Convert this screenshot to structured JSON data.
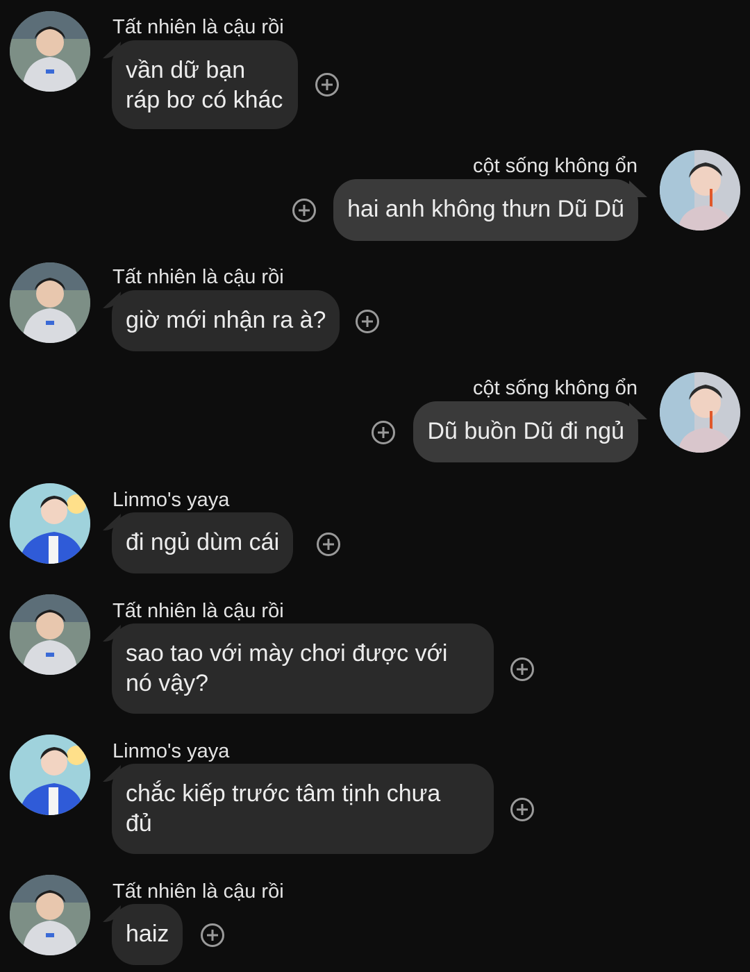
{
  "messages": [
    {
      "side": "left",
      "sender": "Tất nhiên là cậu rồi",
      "text": "vần dữ bạn\nráp bơ có khác",
      "avatar_icon": "hoodie-avatar-icon"
    },
    {
      "side": "right",
      "sender": "cột sống không ổn",
      "text": "hai anh không thưn Dũ Dũ",
      "avatar_icon": "straw-avatar-icon"
    },
    {
      "side": "left",
      "sender": "Tất nhiên là cậu rồi",
      "text": "giờ mới nhận ra à?",
      "avatar_icon": "hoodie-avatar-icon"
    },
    {
      "side": "right",
      "sender": "cột sống không ổn",
      "text": "Dũ buồn Dũ đi ngủ",
      "avatar_icon": "straw-avatar-icon"
    },
    {
      "side": "left",
      "sender": "Linmo's yaya",
      "text": "đi ngủ dùm cái",
      "avatar_icon": "blue-suit-avatar-icon"
    },
    {
      "side": "left",
      "sender": "Tất nhiên là cậu rồi",
      "text": "sao tao với mày chơi được với\nnó vậy?",
      "avatar_icon": "hoodie-avatar-icon"
    },
    {
      "side": "left",
      "sender": "Linmo's yaya",
      "text": "chắc kiếp trước tâm tịnh chưa\nđủ",
      "avatar_icon": "blue-suit-avatar-icon"
    },
    {
      "side": "left",
      "sender": "Tất nhiên là cậu rồi",
      "text": "haiz",
      "avatar_icon": "hoodie-avatar-icon"
    }
  ],
  "colors": {
    "background": "#0d0d0d",
    "incoming_bubble": "#2a2a2a",
    "outgoing_bubble": "#3a3a3a",
    "text": "#ededed",
    "react_icon": "#9a9a9a"
  },
  "react_icon": "add-reaction-icon"
}
